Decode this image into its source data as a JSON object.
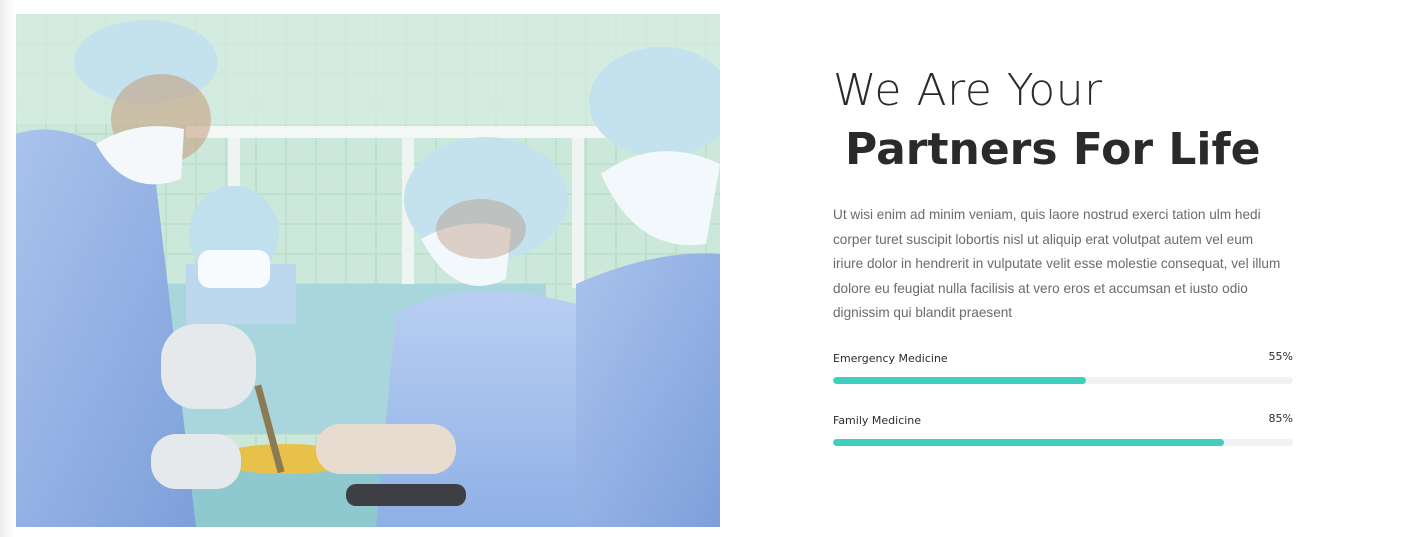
{
  "hero": {
    "title_line1": "We Are Your",
    "title_line2": "Partners For Life",
    "description": "Ut wisi enim ad minim veniam, quis laore nostrud exerci tation ulm hedi corper turet suscipit lobortis nisl ut aliquip erat volutpat autem vel eum iriure dolor in hendrerit in vulputate velit esse molestie consequat, vel illum dolore eu feugiat nulla facilisis at vero eros et accumsan et iusto odio dignissim qui blandit praesent"
  },
  "skills": [
    {
      "label": "Emergency Medicine",
      "percent_label": "55%",
      "value": 55
    },
    {
      "label": "Family Medicine",
      "percent_label": "85%",
      "value": 85
    }
  ],
  "colors": {
    "accent": "#3ecfbf",
    "track": "#f1f2f2",
    "heading": "#2a2a2a",
    "body_text": "#6b6b6b"
  }
}
